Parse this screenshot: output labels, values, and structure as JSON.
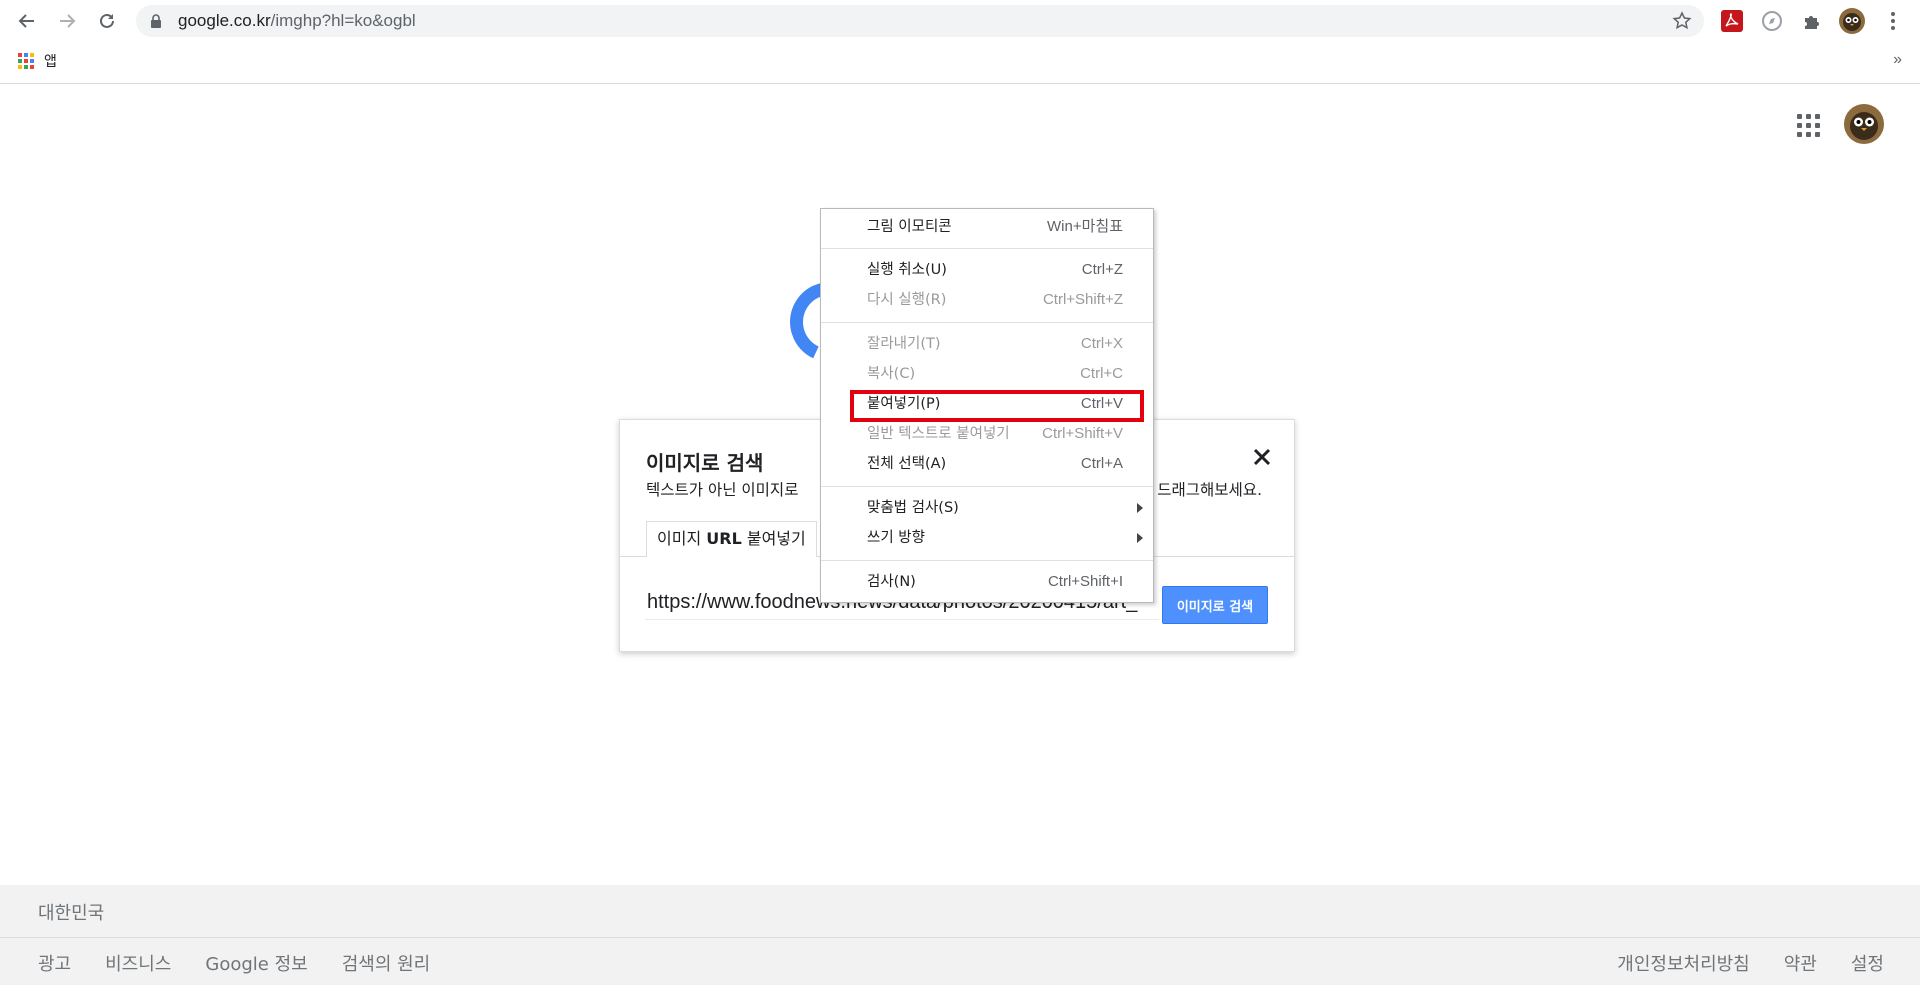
{
  "browser": {
    "url_host": "google.co.kr",
    "url_path": "/imghp?hl=ko&ogbl",
    "bookmarks_apps_label": "앱",
    "bookmarks_more": "»"
  },
  "dialog": {
    "title": "이미지로 검색",
    "desc_left": "텍스트가 아닌 이미지로",
    "desc_right": "드래그해보세요.",
    "tab_prefix": "이미지 ",
    "tab_bold": "URL",
    "tab_suffix": " 붙여넣기",
    "url_value": "https://www.foodnews.news/data/photos/20200415/art_",
    "search_button": "이미지로 검색"
  },
  "context_menu": {
    "items": [
      {
        "label": "그림 이모티콘",
        "shortcut": "Win+마침표",
        "disabled": false
      },
      {
        "label": "실행 취소(U)",
        "shortcut": "Ctrl+Z",
        "disabled": false
      },
      {
        "label": "다시 실행(R)",
        "shortcut": "Ctrl+Shift+Z",
        "disabled": true
      },
      {
        "label": "잘라내기(T)",
        "shortcut": "Ctrl+X",
        "disabled": true
      },
      {
        "label": "복사(C)",
        "shortcut": "Ctrl+C",
        "disabled": true
      },
      {
        "label": "붙여넣기(P)",
        "shortcut": "Ctrl+V",
        "disabled": false
      },
      {
        "label": "일반 텍스트로 붙여넣기",
        "shortcut": "Ctrl+Shift+V",
        "disabled": true
      },
      {
        "label": "전체 선택(A)",
        "shortcut": "Ctrl+A",
        "disabled": false
      },
      {
        "label": "맞춤법 검사(S)",
        "shortcut": "",
        "disabled": false
      },
      {
        "label": "쓰기 방향",
        "shortcut": "",
        "disabled": false
      },
      {
        "label": "검사(N)",
        "shortcut": "Ctrl+Shift+I",
        "disabled": false
      }
    ]
  },
  "footer": {
    "country": "대한민국",
    "left_links": [
      "광고",
      "비즈니스",
      "Google 정보",
      "검색의 원리"
    ],
    "right_links": [
      "개인정보처리방침",
      "약관",
      "설정"
    ]
  },
  "colors": {
    "accent_blue": "#4d90fe",
    "highlight_red": "#e3000f"
  }
}
